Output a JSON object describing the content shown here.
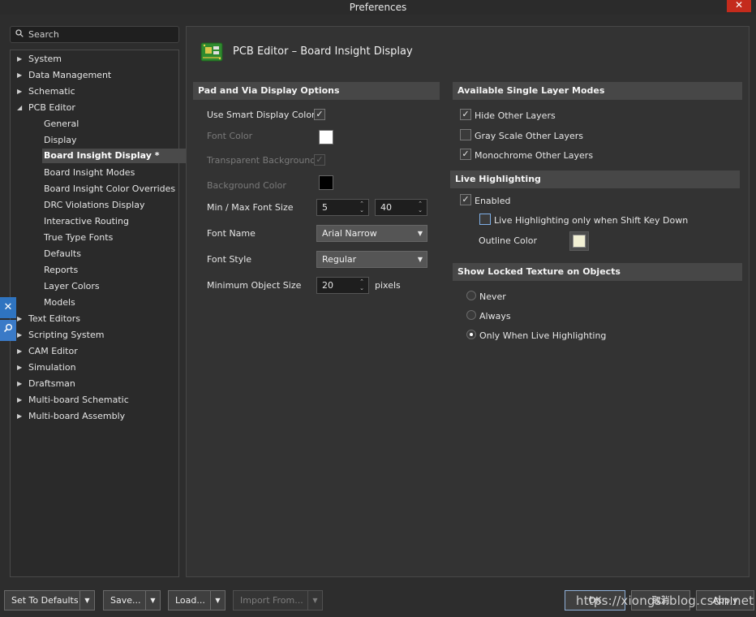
{
  "window": {
    "title": "Preferences",
    "close_glyph": "✕"
  },
  "search": {
    "placeholder": "Search",
    "icon": "search-icon"
  },
  "sidebar": {
    "items": [
      {
        "label": "System",
        "expandable": true,
        "expanded": false
      },
      {
        "label": "Data Management",
        "expandable": true,
        "expanded": false
      },
      {
        "label": "Schematic",
        "expandable": true,
        "expanded": false
      },
      {
        "label": "PCB Editor",
        "expandable": true,
        "expanded": true
      },
      {
        "label": "General"
      },
      {
        "label": "Display"
      },
      {
        "label": "Board Insight Display *",
        "selected": true
      },
      {
        "label": "Board Insight Modes"
      },
      {
        "label": "Board Insight Color Overrides"
      },
      {
        "label": "DRC Violations Display"
      },
      {
        "label": "Interactive Routing"
      },
      {
        "label": "True Type Fonts"
      },
      {
        "label": "Defaults"
      },
      {
        "label": "Reports"
      },
      {
        "label": "Layer Colors"
      },
      {
        "label": "Models"
      },
      {
        "label": "Text Editors",
        "expandable": true,
        "expanded": false
      },
      {
        "label": "Scripting System",
        "expandable": true,
        "expanded": false
      },
      {
        "label": "CAM Editor",
        "expandable": true,
        "expanded": false
      },
      {
        "label": "Simulation",
        "expandable": true,
        "expanded": false
      },
      {
        "label": "Draftsman",
        "expandable": true,
        "expanded": false
      },
      {
        "label": "Multi-board Schematic",
        "expandable": true,
        "expanded": false
      },
      {
        "label": "Multi-board Assembly",
        "expandable": true,
        "expanded": false
      }
    ]
  },
  "page": {
    "title": "PCB Editor – Board Insight Display"
  },
  "pad_via": {
    "header": "Pad and Via Display Options",
    "use_smart_label": "Use Smart Display Color",
    "use_smart_checked": true,
    "font_color_label": "Font Color",
    "font_color": "#ffffff",
    "transparent_bg_label": "Transparent Background",
    "transparent_bg_checked": true,
    "bg_color_label": "Background Color",
    "bg_color": "#000000",
    "min_max_label": "Min / Max Font Size",
    "min_font": "5",
    "max_font": "40",
    "font_name_label": "Font Name",
    "font_name": "Arial Narrow",
    "font_style_label": "Font Style",
    "font_style": "Regular",
    "min_obj_label": "Minimum Object Size",
    "min_obj": "20",
    "min_obj_unit": "pixels"
  },
  "layer_modes": {
    "header": "Available Single Layer Modes",
    "items": [
      {
        "label": "Hide Other Layers",
        "checked": true
      },
      {
        "label": "Gray Scale Other Layers",
        "checked": false
      },
      {
        "label": "Monochrome Other Layers",
        "checked": true
      }
    ]
  },
  "live_highlight": {
    "header": "Live Highlighting",
    "enabled_label": "Enabled",
    "enabled_checked": true,
    "shift_label": "Live Highlighting only when Shift Key Down",
    "shift_checked": false,
    "outline_label": "Outline Color",
    "outline_color": "#f2f0d4"
  },
  "locked_texture": {
    "header": "Show Locked Texture on Objects",
    "options": [
      {
        "label": "Never",
        "selected": false
      },
      {
        "label": "Always",
        "selected": false
      },
      {
        "label": "Only When Live Highlighting",
        "selected": true
      }
    ]
  },
  "footer": {
    "set_defaults": "Set To Defaults",
    "save": "Save...",
    "load": "Load...",
    "import_from": "Import From...",
    "ok": "OK",
    "cancel": "取消",
    "apply": "Apply"
  },
  "watermark": "https://xiongsi.blog.csdn.net"
}
